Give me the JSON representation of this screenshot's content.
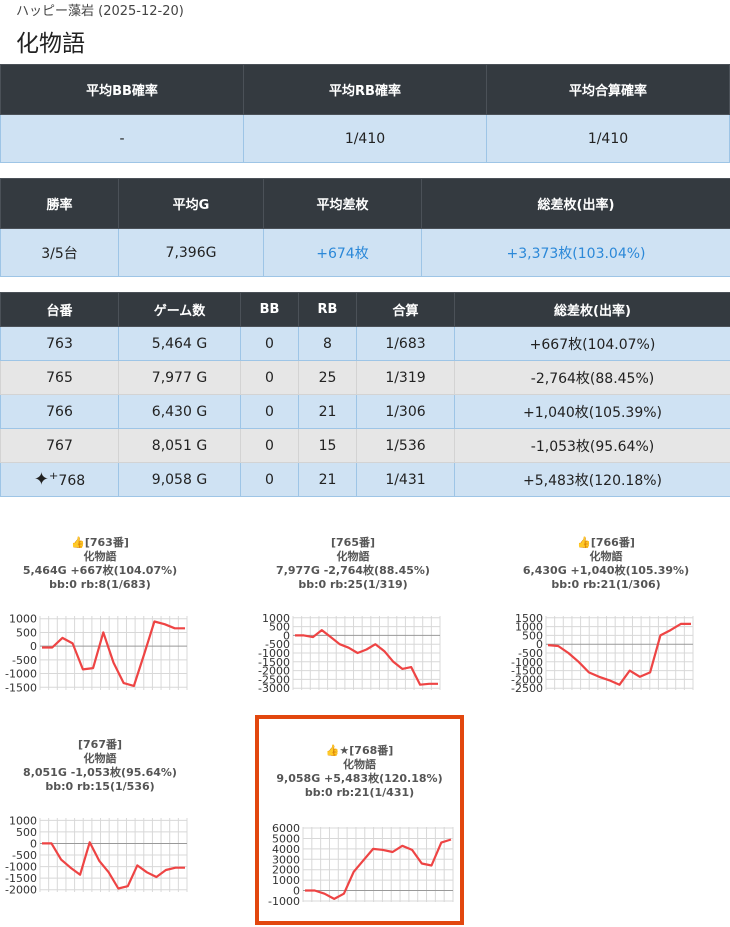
{
  "header": {
    "subtitle": "ハッピー藻岩 (2025-12-20)",
    "title": "化物語"
  },
  "summary1": {
    "headers": [
      "平均BB確率",
      "平均RB確率",
      "平均合算確率"
    ],
    "values": [
      "-",
      "1/410",
      "1/410"
    ]
  },
  "summary2": {
    "headers": [
      "勝率",
      "平均G",
      "平均差枚",
      "総差枚(出率)"
    ],
    "values": [
      "3/5台",
      "7,396G",
      "+674枚",
      "+3,373枚(103.04%)"
    ]
  },
  "machines": {
    "headers": [
      "台番",
      "ゲーム数",
      "BB",
      "RB",
      "合算",
      "総差枚(出率)"
    ],
    "rows": [
      {
        "no": "763",
        "games": "5,464 G",
        "bb": "0",
        "rb": "8",
        "total": "1/683",
        "diff": "+667枚(104.07%)"
      },
      {
        "no": "765",
        "games": "7,977 G",
        "bb": "0",
        "rb": "25",
        "total": "1/319",
        "diff": "-2,764枚(88.45%)"
      },
      {
        "no": "766",
        "games": "6,430 G",
        "bb": "0",
        "rb": "21",
        "total": "1/306",
        "diff": "+1,040枚(105.39%)"
      },
      {
        "no": "767",
        "games": "8,051 G",
        "bb": "0",
        "rb": "15",
        "total": "1/536",
        "diff": "-1,053枚(95.64%)"
      },
      {
        "no": "768",
        "games": "9,058 G",
        "bb": "0",
        "rb": "21",
        "total": "1/431",
        "diff": "+5,483枚(120.18%)",
        "highlight_icon": "sparkles-icon"
      }
    ]
  },
  "cards": [
    {
      "label": "👍[763番]",
      "model": "化物語",
      "stats": "5,464G +667枚(104.07%)",
      "counts": "bb:0 rb:8(1/683)"
    },
    {
      "label": "[765番]",
      "model": "化物語",
      "stats": "7,977G -2,764枚(88.45%)",
      "counts": "bb:0 rb:25(1/319)"
    },
    {
      "label": "👍[766番]",
      "model": "化物語",
      "stats": "6,430G +1,040枚(105.39%)",
      "counts": "bb:0 rb:21(1/306)"
    },
    {
      "label": "[767番]",
      "model": "化物語",
      "stats": "8,051G -1,053枚(95.64%)",
      "counts": "bb:0 rb:15(1/536)"
    },
    {
      "label": "👍★[768番]",
      "model": "化物語",
      "stats": "9,058G +5,483枚(120.18%)",
      "counts": "bb:0 rb:21(1/431)"
    }
  ],
  "chart_data": [
    {
      "type": "line",
      "ticks": [
        1000,
        500,
        0,
        -500,
        -1000,
        -1500
      ],
      "ylim": [
        -1600,
        1100
      ],
      "values": [
        -50,
        -50,
        300,
        100,
        -850,
        -800,
        500,
        -600,
        -1350,
        -1450,
        -300,
        900,
        800,
        650,
        650
      ]
    },
    {
      "type": "line",
      "ticks": [
        1000,
        500,
        0,
        -500,
        -1000,
        -1500,
        -2000,
        -2500,
        -3000
      ],
      "ylim": [
        -3100,
        1100
      ],
      "values": [
        0,
        0,
        -100,
        300,
        -100,
        -500,
        -700,
        -1000,
        -800,
        -500,
        -900,
        -1500,
        -1900,
        -1800,
        -2800,
        -2750,
        -2750
      ]
    },
    {
      "type": "line",
      "ticks": [
        1500,
        1000,
        500,
        0,
        -500,
        -1000,
        -1500,
        -2000,
        -2500
      ],
      "ylim": [
        -2600,
        1600
      ],
      "values": [
        -50,
        -100,
        -500,
        -1000,
        -1600,
        -1850,
        -2050,
        -2300,
        -1500,
        -1850,
        -1600,
        500,
        800,
        1150,
        1150
      ]
    },
    {
      "type": "line",
      "ticks": [
        1000,
        500,
        0,
        -500,
        -1000,
        -1500,
        -2000
      ],
      "ylim": [
        -2100,
        1100
      ],
      "values": [
        0,
        0,
        -700,
        -1050,
        -1350,
        50,
        -750,
        -1250,
        -1950,
        -1850,
        -950,
        -1250,
        -1450,
        -1150,
        -1050,
        -1050
      ]
    },
    {
      "type": "line",
      "ticks": [
        6000,
        5000,
        4000,
        3000,
        2000,
        1000,
        0,
        -1000
      ],
      "ylim": [
        -1100,
        6100
      ],
      "values": [
        0,
        0,
        -300,
        -800,
        -300,
        1800,
        2900,
        4000,
        3900,
        3700,
        4300,
        3900,
        2600,
        2400,
        4600,
        4900
      ]
    }
  ],
  "colors": {
    "line": "#ee4444",
    "header_bg": "#343a40",
    "row_blue": "#cfe2f3",
    "row_gray": "#e6e6e6",
    "positive_text": "#2b88d8",
    "highlight_border": "#e2470e"
  }
}
